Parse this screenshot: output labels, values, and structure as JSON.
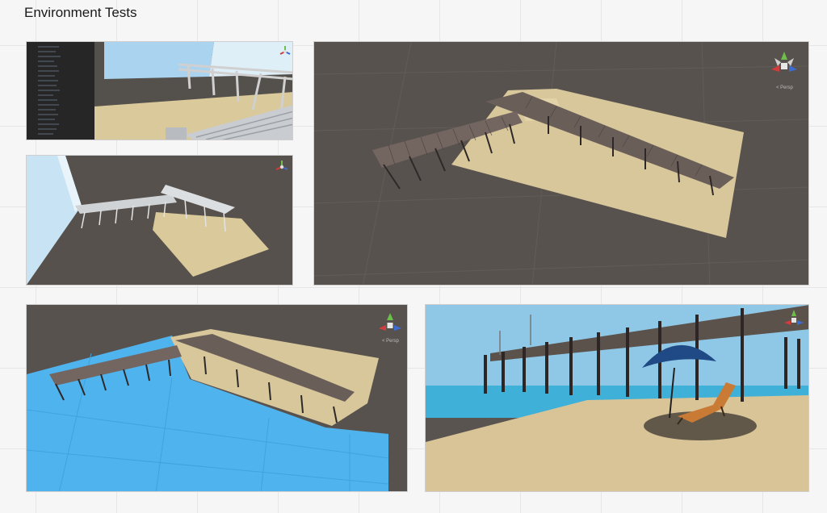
{
  "board": {
    "title": "Environment Tests"
  },
  "viewports": [
    {
      "id": "scene-view-1",
      "gizmo_label": ""
    },
    {
      "id": "scene-view-2",
      "gizmo_label": ""
    },
    {
      "id": "scene-view-3",
      "gizmo_label": "< Persp"
    },
    {
      "id": "scene-view-4",
      "gizmo_label": "< Persp"
    },
    {
      "id": "scene-view-5",
      "gizmo_label": ""
    }
  ],
  "colors": {
    "ground": "#5a5450",
    "sand": "#d8c79b",
    "water": "#4fb3ee",
    "pier": "#6a5e58",
    "sky": "#9ccfe8",
    "umbrella": "#1f4a86",
    "chair": "#c97a35"
  }
}
